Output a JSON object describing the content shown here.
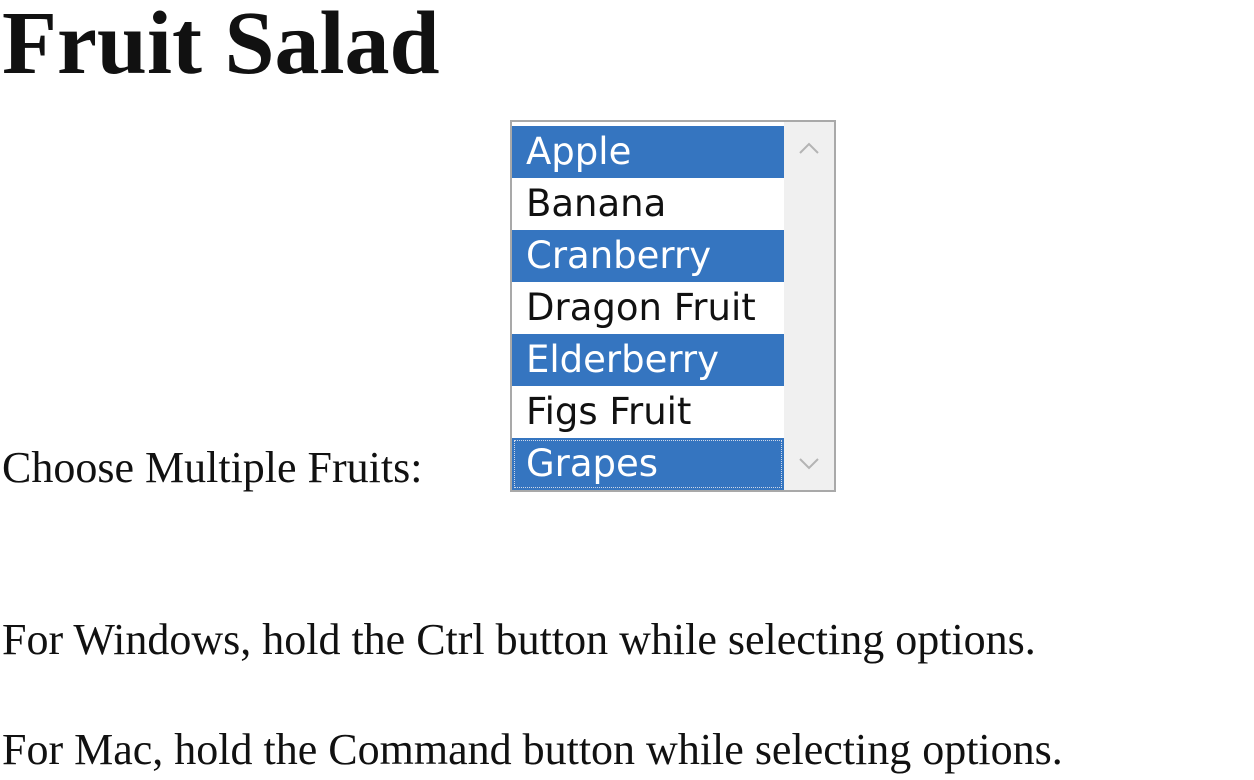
{
  "page": {
    "title": "Fruit Salad"
  },
  "form": {
    "label": "Choose Multiple Fruits:",
    "listbox": {
      "options": [
        {
          "label": "Apple",
          "selected": true
        },
        {
          "label": "Banana",
          "selected": false
        },
        {
          "label": "Cranberry",
          "selected": true
        },
        {
          "label": "Dragon Fruit",
          "selected": false
        },
        {
          "label": "Elderberry",
          "selected": true
        },
        {
          "label": "Figs Fruit",
          "selected": false
        },
        {
          "label": "Grapes",
          "selected": true
        }
      ],
      "scroll_up_icon": "chevron-up-icon",
      "scroll_down_icon": "chevron-down-icon"
    }
  },
  "instructions": {
    "windows": "For Windows, hold the Ctrl button while selecting options.",
    "mac": "For Mac, hold the Command button while selecting options."
  },
  "colors": {
    "selection": "#3575c0",
    "scrollbar_track": "#f0f0f0",
    "border": "#a9a9a9"
  }
}
